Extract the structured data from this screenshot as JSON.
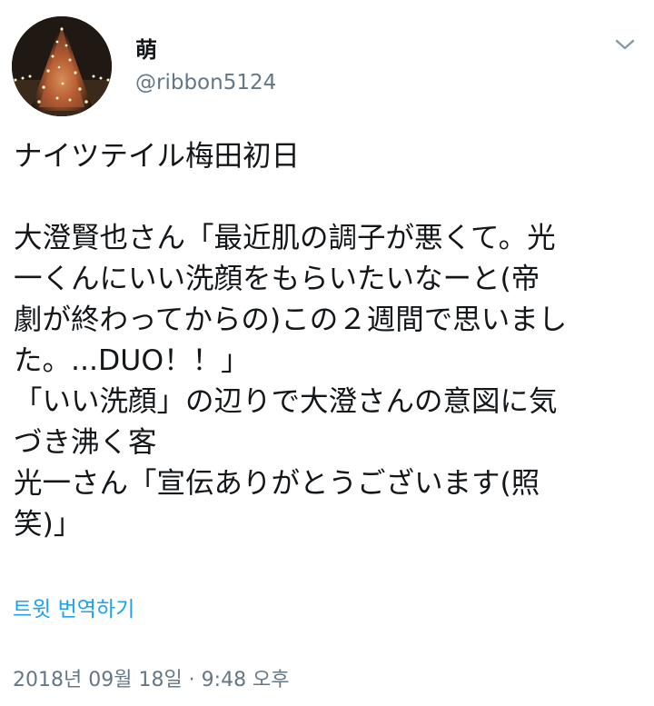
{
  "user": {
    "name": "萌",
    "handle": "@ribbon5124",
    "avatar_icon": "christmas-tree-lights-avatar"
  },
  "menu": {
    "icon": "chevron-down-icon"
  },
  "tweet": {
    "lines": [
      "ナイツテイル梅田初日",
      "",
      "大澄賢也さん「最近肌の調子が悪くて。光",
      "一くんにいい洗顔をもらいたいなーと(帝",
      "劇が終わってからの)この２週間で思いまし",
      "た。...DUO！！」",
      "「いい洗顔」の辺りで大澄さんの意図に気",
      "づき沸く客",
      "光一さん「宣伝ありがとうございます(照",
      "笑)」"
    ],
    "translate_label": "트윗 번역하기",
    "timestamp": "2018년 09월 18일 · 9:48 오후"
  },
  "colors": {
    "text": "#14171a",
    "secondary": "#657786",
    "link": "#1da1f2"
  }
}
